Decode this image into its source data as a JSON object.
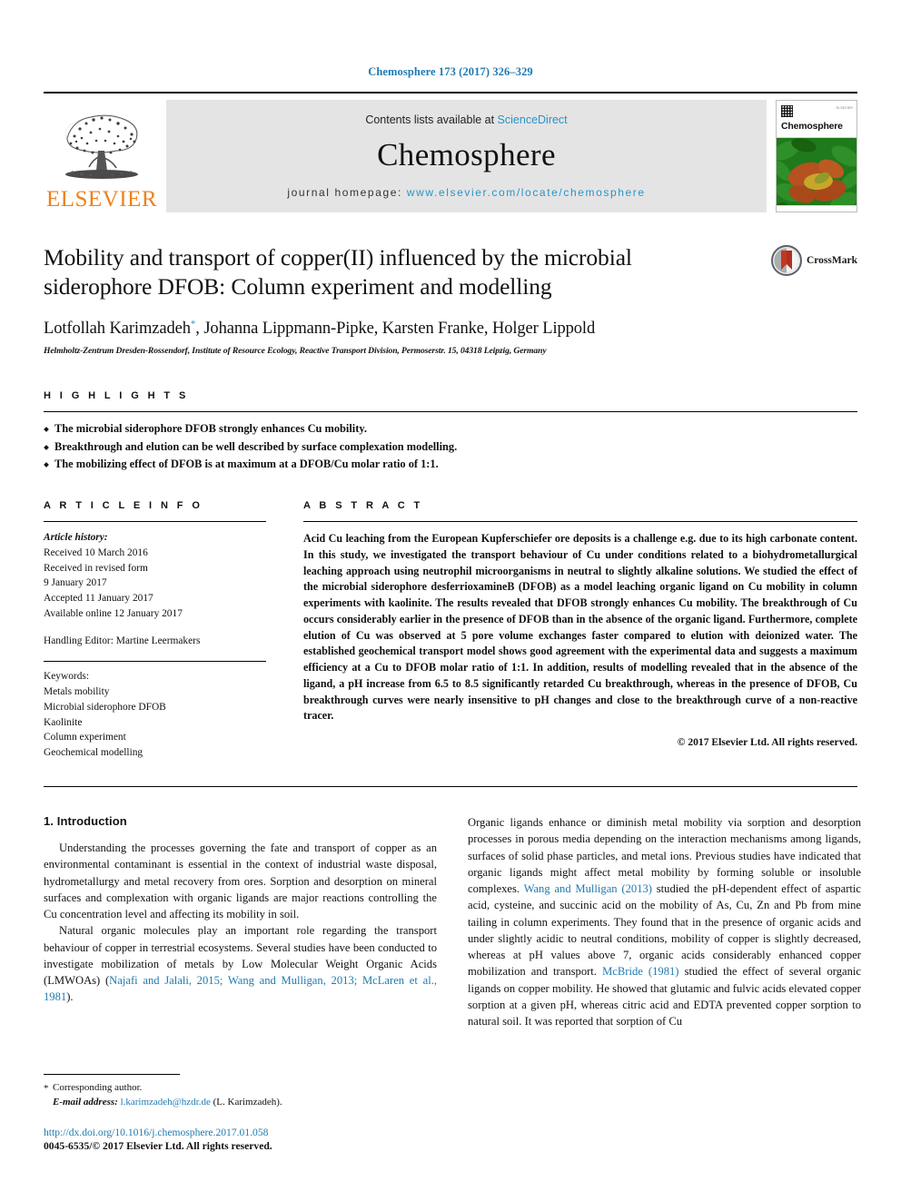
{
  "running_head": "Chemosphere 173 (2017) 326–329",
  "masthead": {
    "contents_prefix": "Contents lists available at ",
    "sciencedirect": "ScienceDirect",
    "journal_name": "Chemosphere",
    "homepage_prefix": "journal homepage: ",
    "homepage_url": "www.elsevier.com/locate/chemosphere",
    "publisher_wordmark": "ELSEVIER",
    "cover_title": "Chemosphere",
    "cover_publisher": "ELSEVIER"
  },
  "title_block": {
    "title": "Mobility and transport of copper(II) influenced by the microbial siderophore DFOB: Column experiment and modelling",
    "authors": "Lotfollah Karimzadeh",
    "authors_rest": ", Johanna Lippmann-Pipke, Karsten Franke, Holger Lippold",
    "corresponding_marker": "*",
    "affiliation": "Helmholtz-Zentrum Dresden-Rossendorf, Institute of Resource Ecology, Reactive Transport Division, Permoserstr. 15, 04318 Leipzig, Germany",
    "crossmark_label": "CrossMark"
  },
  "highlights": {
    "heading": "H I G H L I G H T S",
    "items": [
      "The microbial siderophore DFOB strongly enhances Cu mobility.",
      "Breakthrough and elution can be well described by surface complexation modelling.",
      "The mobilizing effect of DFOB is at maximum at a DFOB/Cu molar ratio of 1:1."
    ]
  },
  "article_info": {
    "heading": "A R T I C L E   I N F O",
    "history_label": "Article history:",
    "history_lines": [
      "Received 10 March 2016",
      "Received in revised form",
      "9 January 2017",
      "Accepted 11 January 2017",
      "Available online 12 January 2017"
    ],
    "handling_editor": "Handling Editor: Martine Leermakers",
    "keywords_label": "Keywords:",
    "keywords": [
      "Metals mobility",
      "Microbial siderophore DFOB",
      "Kaolinite",
      "Column experiment",
      "Geochemical modelling"
    ]
  },
  "abstract": {
    "heading": "A B S T R A C T",
    "text": "Acid Cu leaching from the European Kupferschiefer ore deposits is a challenge e.g. due to its high carbonate content. In this study, we investigated the transport behaviour of Cu under conditions related to a biohydrometallurgical leaching approach using neutrophil microorganisms in neutral to slightly alkaline solutions. We studied the effect of the microbial siderophore desferrioxamineB (DFOB) as a model leaching organic ligand on Cu mobility in column experiments with kaolinite. The results revealed that DFOB strongly enhances Cu mobility. The breakthrough of Cu occurs considerably earlier in the presence of DFOB than in the absence of the organic ligand. Furthermore, complete elution of Cu was observed at 5 pore volume exchanges faster compared to elution with deionized water. The established geochemical transport model shows good agreement with the experimental data and suggests a maximum efficiency at a Cu to DFOB molar ratio of 1:1. In addition, results of modelling revealed that in the absence of the ligand, a pH increase from 6.5 to 8.5 significantly retarded Cu breakthrough, whereas in the presence of DFOB, Cu breakthrough curves were nearly insensitive to pH changes and close to the breakthrough curve of a non-reactive tracer.",
    "copyright": "© 2017 Elsevier Ltd. All rights reserved."
  },
  "introduction": {
    "section_number_title": "1. Introduction",
    "left_paragraph_1": "Understanding the processes governing the fate and transport of copper as an environmental contaminant is essential in the context of industrial waste disposal, hydrometallurgy and metal recovery from ores. Sorption and desorption on mineral surfaces and complexation with organic ligands are major reactions controlling the Cu concentration level and affecting its mobility in soil.",
    "left_paragraph_2_a": "Natural organic molecules play an important role regarding the transport behaviour of copper in terrestrial ecosystems. Several studies have been conducted to investigate mobilization of metals by Low Molecular Weight Organic Acids (LMWOAs) (",
    "left_paragraph_2_ref": "Najafi and Jalali, 2015; Wang and Mulligan, 2013; McLaren et al., 1981",
    "left_paragraph_2_b": ").",
    "right_paragraph_a": "Organic ligands enhance or diminish metal mobility via sorption and desorption processes in porous media depending on the interaction mechanisms among ligands, surfaces of solid phase particles, and metal ions. Previous studies have indicated that organic ligands might affect metal mobility by forming soluble or insoluble complexes. ",
    "right_ref_1": "Wang and Mulligan (2013)",
    "right_paragraph_b": " studied the pH-dependent effect of aspartic acid, cysteine, and succinic acid on the mobility of As, Cu, Zn and Pb from mine tailing in column experiments. They found that in the presence of organic acids and under slightly acidic to neutral conditions, mobility of copper is slightly decreased, whereas at pH values above 7, organic acids considerably enhanced copper mobilization and transport. ",
    "right_ref_2": "McBride (1981)",
    "right_paragraph_c": " studied the effect of several organic ligands on copper mobility. He showed that glutamic and fulvic acids elevated copper sorption at a given pH, whereas citric acid and EDTA prevented copper sorption to natural soil. It was reported that sorption of Cu"
  },
  "footnote": {
    "corresponding_author": "Corresponding author.",
    "email_label": "E-mail address:",
    "email": "l.karimzadeh@hzdr.de",
    "email_suffix": "(L. Karimzadeh).",
    "doi": "http://dx.doi.org/10.1016/j.chemosphere.2017.01.058",
    "issn": "0045-6535/© 2017 Elsevier Ltd. All rights reserved."
  },
  "colors": {
    "link_blue": "#1f7ab0",
    "sciencedirect_blue": "#2a93c9",
    "elsevier_orange": "#f08019",
    "masthead_gray": "#e4e4e4"
  }
}
